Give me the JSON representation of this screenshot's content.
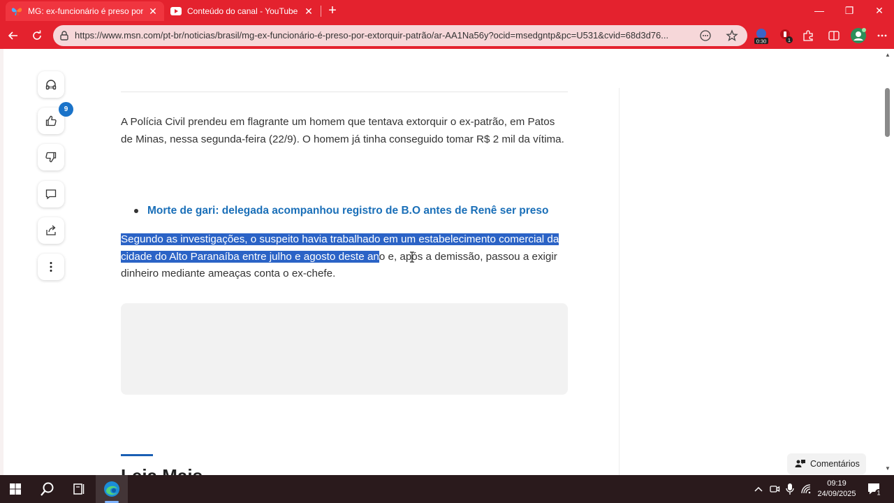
{
  "browser": {
    "tabs": [
      {
        "title": "MG: ex-funcionário é preso por e",
        "active": true
      },
      {
        "title": "Conteúdo do canal - YouTube Stu",
        "active": false
      }
    ],
    "url": "https://www.msn.com/pt-br/noticias/brasil/mg-ex-funcionário-é-preso-por-extorquir-patrão/ar-AA1Na56y?ocid=msedgntp&pc=U531&cvid=68d3d76...",
    "extension_badge_timer": "0:30",
    "extension_badge_count": "1",
    "accent_color": "#e4222e"
  },
  "sidebar": {
    "like_count": "9",
    "items": [
      "listen-icon",
      "like-icon",
      "dislike-icon",
      "comment-icon",
      "share-icon",
      "more-icon"
    ]
  },
  "article": {
    "para1": "A Polícia Civil prendeu em flagrante um homem que tentava extorquir o ex-patrão, em Patos de Minas, nessa segunda-feira (22/9). O homem já tinha conseguido tomar R$ 2 mil da vítima.",
    "related_link": "Morte de gari: delegada acompanhou registro de B.O antes de Renê ser preso",
    "para2_selected": "Segundo as investigações, o suspeito havia trabalhado em um estabelecimento comercial da cidade do Alto Paranaíba entre julho e agosto deste an",
    "para2_rest": "o e, após a demissão, passou a exigir dinheiro mediante ameaças conta o ex-chefe.",
    "heading_peek": "Leia Mais",
    "comments_label": "Comentários"
  },
  "taskbar": {
    "time": "09:19",
    "date": "24/09/2025",
    "notification_count": "1"
  }
}
